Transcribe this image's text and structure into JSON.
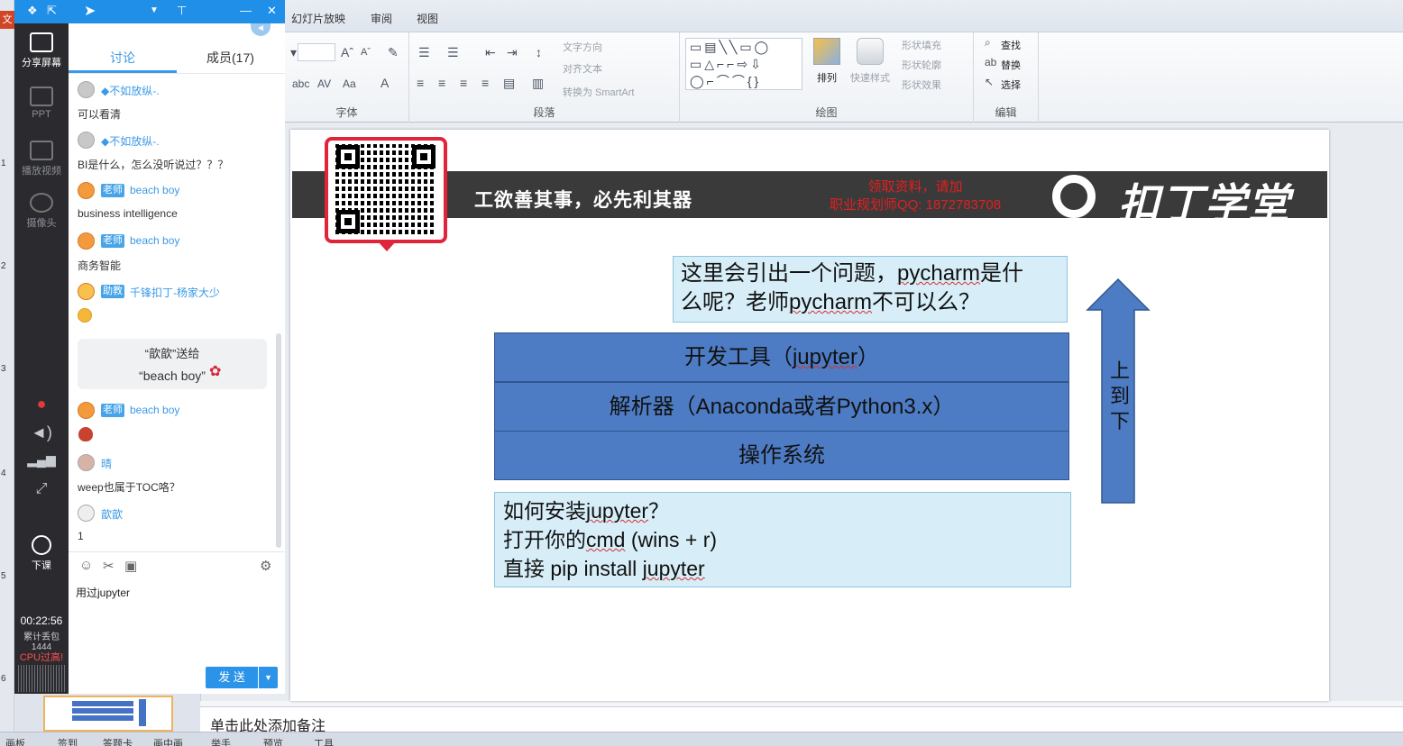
{
  "ppt": {
    "file_tab": "文",
    "tabs": [
      "幻灯片放映",
      "审阅",
      "视图"
    ],
    "ribbon": {
      "font_group": "字体",
      "paragraph_group": "段落",
      "drawing_group": "绘图",
      "editing_group": "编辑",
      "text_direction": "文字方向",
      "align_text": "对齐文本",
      "convert_smartart": "转换为 SmartArt",
      "arrange": "排列",
      "quick_styles": "快速样式",
      "shape_fill": "形状填充",
      "shape_outline": "形状轮廓",
      "shape_effects": "形状效果",
      "find": "查找",
      "replace": "替换",
      "select": "选择"
    },
    "notes_placeholder": "单击此处添加备注",
    "statusbar": [
      "画板",
      "签到",
      "答题卡",
      "画中画",
      "举手",
      "预览",
      "工具"
    ],
    "thumb_numbers": [
      "1",
      "2",
      "3",
      "4",
      "5",
      "6"
    ]
  },
  "slide": {
    "banner_title": "工欲善其事，必先利其器",
    "banner_red_line1": "领取资料，请加",
    "banner_red_line2": "职业规划师QQ: 1872783708",
    "logo": "扣丁学堂",
    "callout_line1a": "这里会引出一个问题，",
    "callout_line1b": "pycharm",
    "callout_line1c": "是什",
    "callout_line2a": "么呢？老师",
    "callout_line2b": "pycharm",
    "callout_line2c": "不可以么？",
    "stack_top_a": "开发工具（",
    "stack_top_b": "jupyter",
    "stack_top_c": "）",
    "stack_mid": "解析器（Anaconda或者Python3.x）",
    "stack_bottom": "操作系统",
    "install_line1a": "如何安装",
    "install_line1b": "jupyter",
    "install_line1c": "？",
    "install_line2a": "打开你的",
    "install_line2b": "cmd",
    "install_line2c": " (wins + r)",
    "install_line3a": "直接 pip install ",
    "install_line3b": "jupyter",
    "arrow_label_1": "上",
    "arrow_label_2": "到",
    "arrow_label_3": "下",
    "arrow_color": "#4d7cc4"
  },
  "live": {
    "share_screen": "分享屏幕",
    "ppt": "PPT",
    "play_video": "播放视频",
    "camera": "摄像头",
    "end_class": "下课",
    "timer": "00:22:56",
    "packet_loss_label": "累计丢包",
    "packet_loss_value": "1444",
    "cpu_warning": "CPU过高!"
  },
  "chat": {
    "tab_discussion": "讨论",
    "tab_members": "成员(17)",
    "messages": [
      {
        "role": "",
        "name": "不如放纵-.",
        "text": "可以看清"
      },
      {
        "role": "",
        "name": "不如放纵-.",
        "text": "BI是什么，怎么没听说过？？？"
      },
      {
        "role": "老师",
        "name": "beach boy",
        "text": "business intelligence"
      },
      {
        "role": "老师",
        "name": "beach boy",
        "text": "商务智能"
      },
      {
        "role": "助教",
        "name": "千锋扣丁-杨家大少",
        "text": ""
      },
      {
        "role": "老师",
        "name": "beach boy",
        "text": ""
      },
      {
        "role": "",
        "name": "晴",
        "text": "weep也属于TOC咯？"
      },
      {
        "role": "",
        "name": "歆歆",
        "text": "1"
      }
    ],
    "gift_line1": "“歆歆”送给",
    "gift_line2": "“beach boy”",
    "input_value": "用过jupyter",
    "send": "发 送",
    "accent": "#2b93e8"
  }
}
